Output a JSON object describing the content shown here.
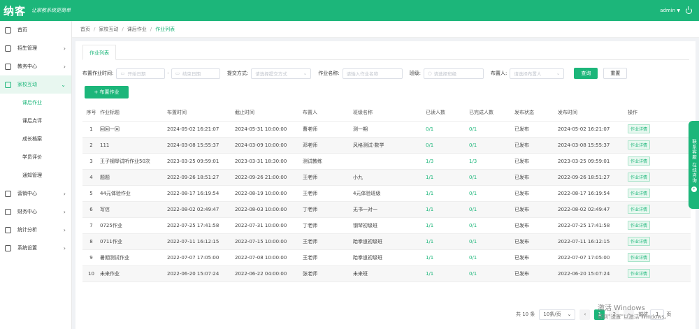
{
  "header": {
    "logo": "纳客",
    "slogan": "让家教系统更简单",
    "user": "admin",
    "caret": "▼"
  },
  "sidebar": {
    "items": [
      {
        "label": "首页",
        "icon": "home-icon",
        "arrow": ""
      },
      {
        "label": "招生管理",
        "icon": "user-icon",
        "arrow": "›"
      },
      {
        "label": "教务中心",
        "icon": "book-icon",
        "arrow": "›"
      },
      {
        "label": "家校互动",
        "icon": "chat-icon",
        "arrow": "⌄",
        "active": true
      },
      {
        "label": "营销中心",
        "icon": "gift-icon",
        "arrow": "›"
      },
      {
        "label": "财务中心",
        "icon": "wallet-icon",
        "arrow": "›"
      },
      {
        "label": "统计分析",
        "icon": "chart-icon",
        "arrow": "›"
      },
      {
        "label": "系统设置",
        "icon": "settings-icon",
        "arrow": "›"
      }
    ],
    "subitems": [
      "课后作业",
      "课后点评",
      "成长档案",
      "学员评价",
      "通知管理"
    ]
  },
  "breadcrumb": [
    "首页",
    "家校互动",
    "课后作业",
    "作业列表"
  ],
  "tab": "作业列表",
  "filters": {
    "time_label": "布置作业时间:",
    "start_ph": "开始日期",
    "dash": "-",
    "end_ph": "结束日期",
    "mode_label": "提交方式:",
    "mode_ph": "请选择提交方式",
    "name_label": "作业名称:",
    "name_ph": "请输入作业名称",
    "class_label": "班级:",
    "class_ph": "请选择班级",
    "teacher_label": "布置人:",
    "teacher_ph": "请选择布置人",
    "search": "查询",
    "reset": "重置"
  },
  "add_button": "+ 布置作业",
  "table": {
    "headers": [
      "序号",
      "作业标题",
      "布置时间",
      "截止时间",
      "布置人",
      "班级名称",
      "已读人数",
      "已完成人数",
      "发布状态",
      "发布时间",
      "操作"
    ],
    "rows": [
      [
        "1",
        "回回一回",
        "2024-05-02 16:21:07",
        "2024-05-31 10:00:00",
        "曹老师",
        "测一期",
        "0/1",
        "0/1",
        "已发布",
        "2024-05-02 16:21:07",
        "作业详情"
      ],
      [
        "2",
        "111",
        "2024-03-08 15:55:37",
        "2024-03-09 10:00:00",
        "邓老师",
        "风格测试-数学",
        "0/1",
        "0/1",
        "已发布",
        "2024-03-08 15:55:37",
        "作业详情"
      ],
      [
        "3",
        "王子钢琴试听作业50次",
        "2023-03-25 09:59:01",
        "2023-03-31 18:30:00",
        "测试教练",
        "",
        "1/3",
        "1/3",
        "已发布",
        "2023-03-25 09:59:01",
        "作业详情"
      ],
      [
        "4",
        "题题",
        "2022-09-26 18:51:27",
        "2022-09-26 21:00:00",
        "王老师",
        "小九",
        "1/1",
        "0/1",
        "已发布",
        "2022-09-26 18:51:27",
        "作业详情"
      ],
      [
        "5",
        "44元体验作业",
        "2022-08-17 16:19:54",
        "2022-08-19 10:00:00",
        "王老师",
        "4元体验班级",
        "1/1",
        "0/1",
        "已发布",
        "2022-08-17 16:19:54",
        "作业详情"
      ],
      [
        "6",
        "写信",
        "2022-08-02 02:49:47",
        "2022-08-03 10:00:00",
        "丁老师",
        "无书一对一",
        "1/1",
        "0/1",
        "已发布",
        "2022-08-02 02:49:47",
        "作业详情"
      ],
      [
        "7",
        "0725作业",
        "2022-07-25 17:41:58",
        "2022-07-31 10:00:00",
        "丁老师",
        "钢琴初级班",
        "1/1",
        "0/1",
        "已发布",
        "2022-07-25 17:41:58",
        "作业详情"
      ],
      [
        "8",
        "0711作业",
        "2022-07-11 16:12:15",
        "2022-07-15 10:00:00",
        "王老师",
        "跆拳道初级班",
        "1/1",
        "0/1",
        "已发布",
        "2022-07-11 16:12:15",
        "作业详情"
      ],
      [
        "9",
        "暑期测试作业",
        "2022-07-07 17:05:00",
        "2022-07-08 10:00:00",
        "王老师",
        "跆拳道初级班",
        "1/1",
        "0/1",
        "已发布",
        "2022-07-07 17:05:00",
        "作业详情"
      ],
      [
        "10",
        "未来作业",
        "2022-06-20 15:07:24",
        "2022-06-22 04:00:00",
        "张老师",
        "未来班",
        "1/1",
        "0/1",
        "已发布",
        "2022-06-20 15:07:24",
        "作业详情"
      ]
    ]
  },
  "pager": {
    "total": "共 10 条",
    "size": "10条/页",
    "prev": "‹",
    "pages": [
      "1",
      "2"
    ],
    "next": "›",
    "goto": "前往",
    "page_value": "1",
    "page_unit": "页"
  },
  "float": {
    "text": "联系客服 在线咨询",
    "icon": "»"
  },
  "watermark": {
    "line1": "激活 Windows",
    "line2": "转到\"设置\"以激活 Windows。"
  }
}
